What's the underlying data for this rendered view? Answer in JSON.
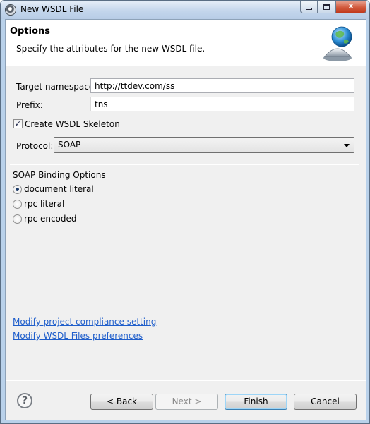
{
  "window": {
    "title": "New WSDL File",
    "close_glyph": "X"
  },
  "banner": {
    "heading": "Options",
    "description": "Specify the attributes for the new WSDL file."
  },
  "form": {
    "target_namespace_label": "Target namespace:",
    "target_namespace_value": "http://ttdev.com/ss",
    "prefix_label": "Prefix:",
    "prefix_value": "tns",
    "create_skeleton_label": "Create WSDL Skeleton",
    "create_skeleton_checked": true,
    "protocol_label": "Protocol:",
    "protocol_value": "SOAP"
  },
  "binding": {
    "group_label": "SOAP Binding Options",
    "options": [
      {
        "label": "document literal",
        "selected": true
      },
      {
        "label": "rpc literal",
        "selected": false
      },
      {
        "label": "rpc encoded",
        "selected": false
      }
    ]
  },
  "links": {
    "compliance": "Modify project compliance setting",
    "preferences": "Modify WSDL Files preferences"
  },
  "buttons": {
    "help_glyph": "?",
    "back": "< Back",
    "next": "Next >",
    "finish": "Finish",
    "cancel": "Cancel"
  },
  "colors": {
    "link": "#1f5ecb",
    "dialog_bg": "#f0f0f0",
    "title_bar": "#c4d6ec"
  },
  "icons": {
    "banner": "globe-bell-icon",
    "help": "help-icon",
    "app": "eclipse-icon"
  }
}
